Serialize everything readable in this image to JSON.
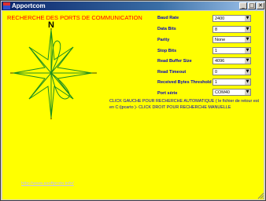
{
  "window": {
    "title": "Apportcom",
    "minimize_glyph": "_",
    "maximize_glyph": "□",
    "close_glyph": "✕"
  },
  "heading": "RECHERCHE DES PORTS DE COMMUNICATION",
  "compass": {
    "north_label": "N"
  },
  "settings": [
    {
      "label": "Baud Rate",
      "value": "2400"
    },
    {
      "label": "Data Bits",
      "value": "8"
    },
    {
      "label": "Parity",
      "value": "None"
    },
    {
      "label": "Stop Bits",
      "value": "1"
    },
    {
      "label": "Read Buffer Size",
      "value": "4096"
    },
    {
      "label": "Read Timeout",
      "value": "0"
    },
    {
      "label": "Received Bytes Threshold",
      "value": "1"
    },
    {
      "label": "Port série",
      "value": "COM40"
    }
  ],
  "instructions": "CLICK GAUCHE POUR RECHERCHE AUTOMATIQUE ( le fichier de retour est en C:/jpcarto )- CLICK DROIT POUR RECHERCHE MANUELLE",
  "link": "http://www.asoftproto.info/",
  "colors": {
    "background": "#ffff00",
    "heading": "#ff0000",
    "labels": "#0000c0",
    "compass": "#1e8f1e",
    "titlebar": "#0a246a"
  }
}
